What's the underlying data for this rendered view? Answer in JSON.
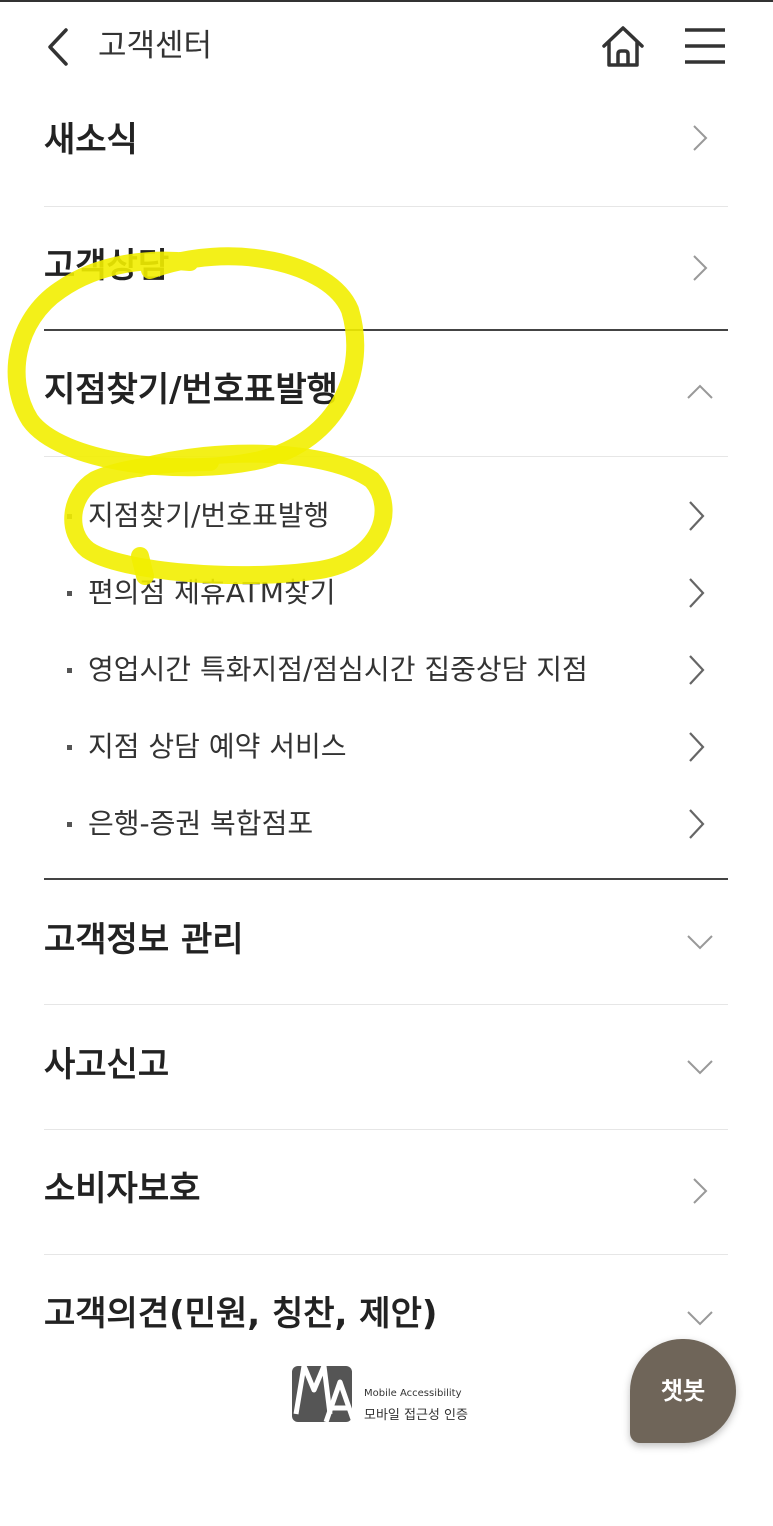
{
  "header": {
    "title": "고객센터"
  },
  "menu": {
    "news": "새소식",
    "consult": "고객상담",
    "branch": "지점찾기/번호표발행",
    "info": "고객정보 관리",
    "accident": "사고신고",
    "protection": "소비자보호",
    "opinion": "고객의견(민원, 칭찬, 제안)"
  },
  "branch_sub": [
    "지점찾기/번호표발행",
    "편의점 제휴ATM찾기",
    "영업시간 특화지점/점심시간 집중상담 지점",
    "지점 상담 예약 서비스",
    "은행-증권 복합점포"
  ],
  "footer": {
    "ma_line1": "Mobile Accessibility",
    "ma_line2": "모바일 접근성 인증"
  },
  "chatbot": {
    "label": "챗봇"
  },
  "colors": {
    "highlight": "#f2ee00",
    "chatbot_bg": "#6f6559"
  }
}
